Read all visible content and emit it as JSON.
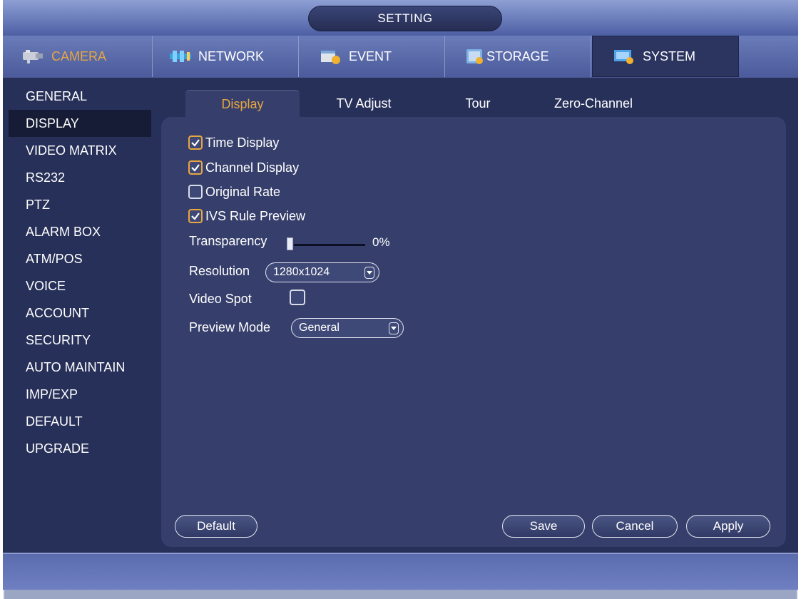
{
  "window": {
    "title": "SETTING"
  },
  "top_tabs": [
    {
      "label": "CAMERA",
      "icon": "camera-icon",
      "active": false,
      "highlight": "#e8a640"
    },
    {
      "label": "NETWORK",
      "icon": "network-icon",
      "active": false
    },
    {
      "label": "EVENT",
      "icon": "event-icon",
      "active": false
    },
    {
      "label": "STORAGE",
      "icon": "storage-icon",
      "active": false
    },
    {
      "label": "SYSTEM",
      "icon": "system-icon",
      "active": true
    }
  ],
  "sidebar": {
    "items": [
      {
        "label": "GENERAL"
      },
      {
        "label": "DISPLAY",
        "active": true
      },
      {
        "label": "VIDEO MATRIX"
      },
      {
        "label": "RS232"
      },
      {
        "label": "PTZ"
      },
      {
        "label": "ALARM BOX"
      },
      {
        "label": "ATM/POS"
      },
      {
        "label": "VOICE"
      },
      {
        "label": "ACCOUNT"
      },
      {
        "label": "SECURITY"
      },
      {
        "label": "AUTO MAINTAIN"
      },
      {
        "label": "IMP/EXP"
      },
      {
        "label": "DEFAULT"
      },
      {
        "label": "UPGRADE"
      }
    ]
  },
  "sub_tabs": [
    {
      "label": "Display",
      "active": true
    },
    {
      "label": "TV Adjust"
    },
    {
      "label": "Tour"
    },
    {
      "label": "Zero-Channel"
    }
  ],
  "options": {
    "time_display": {
      "label": "Time Display",
      "checked": true
    },
    "channel_display": {
      "label": "Channel Display",
      "checked": true
    },
    "original_rate": {
      "label": "Original Rate",
      "checked": false
    },
    "ivs_rule_preview": {
      "label": "IVS Rule Preview",
      "checked": true
    }
  },
  "transparency": {
    "label": "Transparency",
    "value_text": "0%",
    "value": 0
  },
  "resolution": {
    "label": "Resolution",
    "value": "1280x1024"
  },
  "video_spot": {
    "label": "Video Spot",
    "checked": false
  },
  "preview_mode": {
    "label": "Preview Mode",
    "value": "General"
  },
  "buttons": {
    "default": "Default",
    "save": "Save",
    "cancel": "Cancel",
    "apply": "Apply"
  },
  "colors": {
    "accent": "#e8a640",
    "panel": "#363f6b",
    "background": "#273059"
  }
}
